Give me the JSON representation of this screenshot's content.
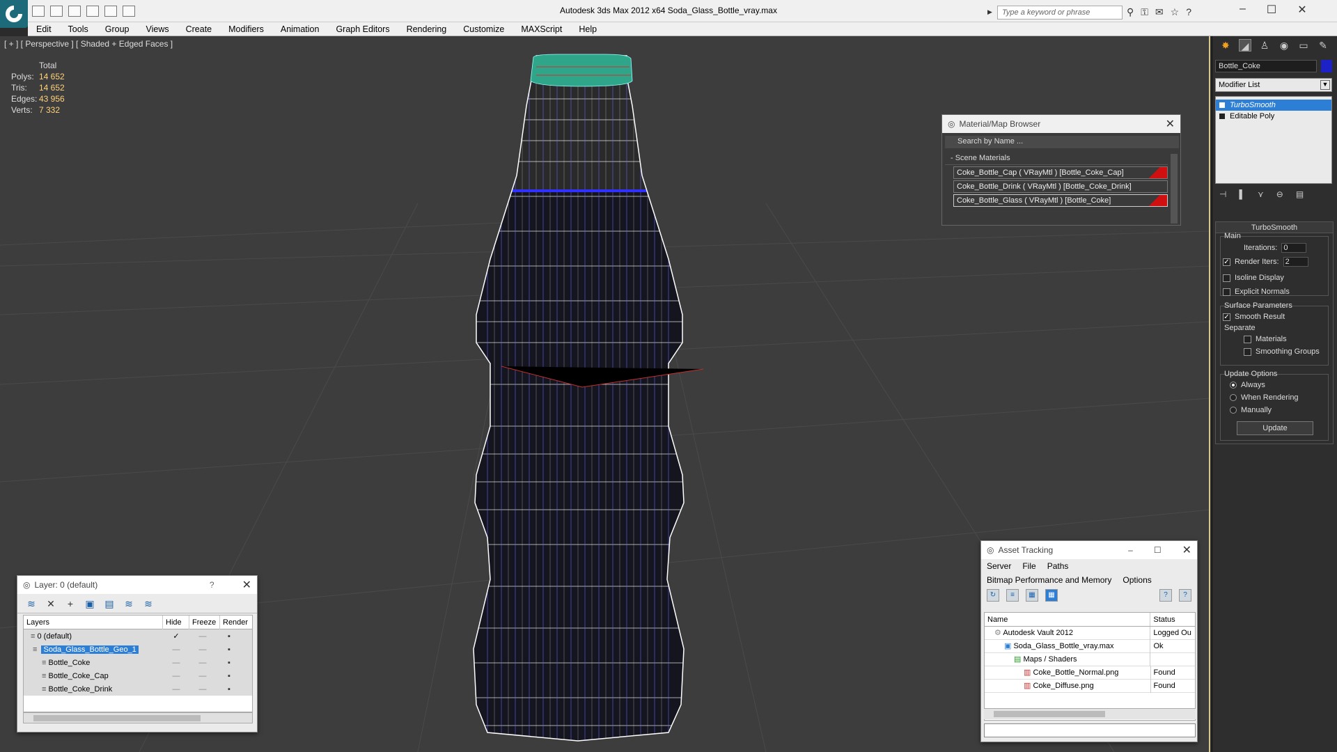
{
  "titlebar": {
    "title": "Autodesk 3ds Max  2012 x64        Soda_Glass_Bottle_vray.max",
    "search_placeholder": "Type a keyword or phrase"
  },
  "menubar": {
    "items": [
      "Edit",
      "Tools",
      "Group",
      "Views",
      "Create",
      "Modifiers",
      "Animation",
      "Graph Editors",
      "Rendering",
      "Customize",
      "MAXScript",
      "Help"
    ]
  },
  "viewport": {
    "label": "[ + ] [ Perspective ] [ Shaded + Edged Faces ]",
    "stats_header": "Total",
    "stats": [
      {
        "k": "Polys:",
        "v": "14 652"
      },
      {
        "k": "Tris:",
        "v": "14 652"
      },
      {
        "k": "Edges:",
        "v": "43 956"
      },
      {
        "k": "Verts:",
        "v": "7 332"
      }
    ]
  },
  "material_browser": {
    "title": "Material/Map Browser",
    "search_placeholder": "Search by Name ...",
    "section": "- Scene Materials",
    "materials": [
      "Coke_Bottle_Cap  ( VRayMtl ) [Bottle_Coke_Cap]",
      "Coke_Bottle_Drink  ( VRayMtl ) [Bottle_Coke_Drink]",
      "Coke_Bottle_Glass  ( VRayMtl ) [Bottle_Coke]"
    ]
  },
  "layer_panel": {
    "title": "Layer: 0 (default)",
    "help": "?",
    "columns": [
      "Layers",
      "Hide",
      "Freeze",
      "Render"
    ],
    "rows": [
      {
        "name": "0 (default)",
        "indent": 0
      },
      {
        "name": "Soda_Glass_Bottle_Geo_1",
        "indent": 0
      },
      {
        "name": "Bottle_Coke",
        "indent": 1
      },
      {
        "name": "Bottle_Coke_Cap",
        "indent": 1
      },
      {
        "name": "Bottle_Coke_Drink",
        "indent": 1
      }
    ]
  },
  "asset_tracking": {
    "title": "Asset Tracking",
    "menu1": [
      "Server",
      "File",
      "Paths"
    ],
    "menu2": [
      "Bitmap Performance and Memory",
      "Options"
    ],
    "columns": [
      "Name",
      "Status"
    ],
    "rows": [
      {
        "name": "Autodesk Vault 2012",
        "status": "Logged Ou",
        "indent": 1
      },
      {
        "name": "Soda_Glass_Bottle_vray.max",
        "status": "Ok",
        "indent": 2
      },
      {
        "name": "Maps / Shaders",
        "status": "",
        "indent": 3
      },
      {
        "name": "Coke_Bottle_Normal.png",
        "status": "Found",
        "indent": 4
      },
      {
        "name": "Coke_Diffuse.png",
        "status": "Found",
        "indent": 4
      }
    ]
  },
  "command_panel": {
    "object_name": "Bottle_Coke",
    "object_color": "#1c22c8",
    "modifier_list": "Modifier List",
    "stack": [
      "TurboSmooth",
      "Editable Poly"
    ],
    "turbosmooth": {
      "title": "TurboSmooth",
      "main": "Main",
      "iterations_label": "Iterations:",
      "iterations": "0",
      "render_iters_label": "Render Iters:",
      "render_iters": "2",
      "isoline": "Isoline Display",
      "explicit_normals": "Explicit Normals",
      "surface_params": "Surface Parameters",
      "smooth_result": "Smooth Result",
      "separate": "Separate",
      "materials": "Materials",
      "smoothing_groups": "Smoothing Groups",
      "update_options": "Update Options",
      "always": "Always",
      "when_rendering": "When Rendering",
      "manually": "Manually",
      "update": "Update"
    }
  }
}
